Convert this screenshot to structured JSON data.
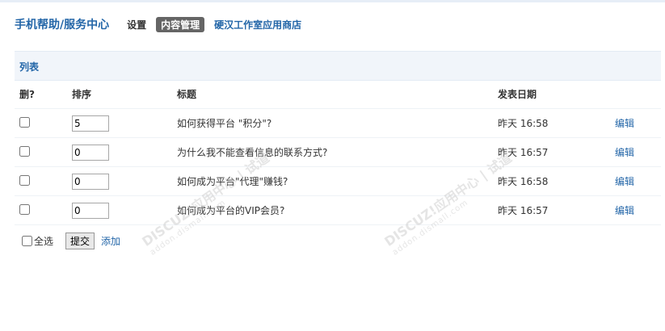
{
  "header": {
    "title": "手机帮助/服务中心",
    "nav": [
      {
        "label": "设置"
      },
      {
        "label": "内容管理",
        "active": true
      },
      {
        "label": "硬汉工作室应用商店"
      }
    ]
  },
  "section": {
    "title": "列表"
  },
  "table": {
    "headers": {
      "del": "删?",
      "order": "排序",
      "title": "标题",
      "date": "发表日期"
    },
    "rows": [
      {
        "order": "5",
        "title": "如何获得平台 \"积分\"?",
        "date": "昨天 16:58",
        "action": "编辑"
      },
      {
        "order": "0",
        "title": "为什么我不能查看信息的联系方式?",
        "date": "昨天 16:57",
        "action": "编辑"
      },
      {
        "order": "0",
        "title": "如何成为平台\"代理\"赚钱?",
        "date": "昨天 16:58",
        "action": "编辑"
      },
      {
        "order": "0",
        "title": "如何成为平台的VIP会员?",
        "date": "昨天 16:57",
        "action": "编辑"
      }
    ]
  },
  "footer": {
    "select_all": "全选",
    "submit": "提交",
    "add": "添加"
  },
  "watermark": {
    "brand": "DISCUZ!应用中心 | 试道",
    "url": "addon.dismall.com"
  }
}
